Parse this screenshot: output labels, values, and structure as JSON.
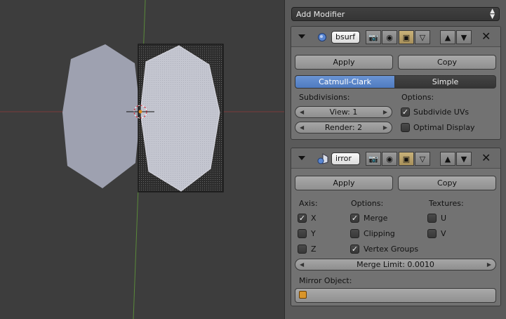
{
  "panel": {
    "add_modifier_label": "Add Modifier",
    "modifiers": [
      {
        "name": "bsurf",
        "type_icon": "subsurf-modifier-icon",
        "apply_label": "Apply",
        "copy_label": "Copy",
        "tabs": [
          {
            "label": "Catmull-Clark",
            "active": true
          },
          {
            "label": "Simple",
            "active": false
          }
        ],
        "subdivisions_label": "Subdivisions:",
        "view_field": "View: 1",
        "render_field": "Render: 2",
        "options_label": "Options:",
        "options": [
          {
            "label": "Subdivide UVs",
            "checked": true
          },
          {
            "label": "Optimal Display",
            "checked": false
          }
        ]
      },
      {
        "name": "irror",
        "type_icon": "mirror-modifier-icon",
        "apply_label": "Apply",
        "copy_label": "Copy",
        "axis_label": "Axis:",
        "axis": [
          {
            "label": "X",
            "checked": true
          },
          {
            "label": "Y",
            "checked": false
          },
          {
            "label": "Z",
            "checked": false
          }
        ],
        "options_label": "Options:",
        "options": [
          {
            "label": "Merge",
            "checked": true
          },
          {
            "label": "Clipping",
            "checked": false
          },
          {
            "label": "Vertex Groups",
            "checked": true
          }
        ],
        "textures_label": "Textures:",
        "textures": [
          {
            "label": "U",
            "checked": false
          },
          {
            "label": "V",
            "checked": false
          }
        ],
        "merge_limit": "Merge Limit: 0.0010",
        "mirror_object_label": "Mirror Object:",
        "mirror_object_value": ""
      }
    ]
  },
  "colors": {
    "viewport_bg": "#3d3d3d",
    "panel_bg": "#727272",
    "active_tab": "#5680c2",
    "mesh_fill": "#9da0b0"
  }
}
